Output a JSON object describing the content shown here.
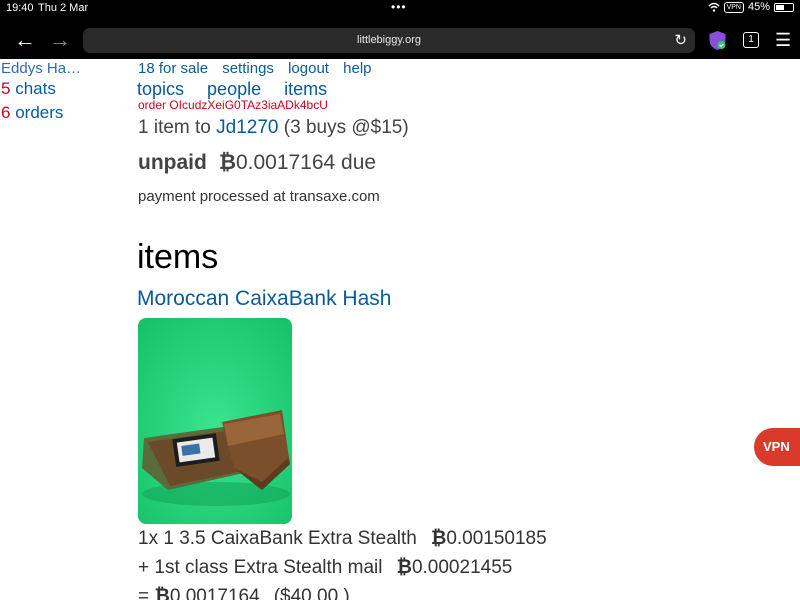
{
  "status_bar": {
    "time": "19:40",
    "date": "Thu 2 Mar",
    "dots": "•••",
    "vpn": "VPN",
    "battery": "45%"
  },
  "browser": {
    "url": "littlebiggy.org",
    "tab_count": "1",
    "back_icon": "←",
    "forward_icon": "→",
    "reload_icon": "↻",
    "menu_icon": "☰"
  },
  "sidebar": {
    "shop_name": "Eddys Ha…",
    "chats_count": "5",
    "chats_label": "chats",
    "orders_count": "6",
    "orders_label": "orders"
  },
  "top_links": [
    "18 for sale",
    "settings",
    "logout",
    "help"
  ],
  "nav_links": [
    "topics",
    "people",
    "items"
  ],
  "order": {
    "id": "order OIcudzXeiG0TAz3iaADk4bcU",
    "summary_prefix": "1 item to",
    "buyer": "Jd1270",
    "summary_suffix": "(3 buys @$15)",
    "status": "unpaid",
    "btc_symbol": "₿",
    "due": "0.0017164 due",
    "processed": "payment processed at transaxe.com"
  },
  "items_heading": "items",
  "product": {
    "title": "Moroccan CaixaBank Hash",
    "line1_text": "1x 1 3.5 CaixaBank Extra Stealth",
    "line1_amount": "0.00150185",
    "line2_text": "+ 1st class Extra Stealth mail",
    "line2_amount": "0.00021455",
    "line3_prefix": "=",
    "line3_amount": "0.0017164",
    "line3_usd": "($40.00 )"
  },
  "vpn_button": "VPN",
  "colors": {
    "link": "#0a5a9a",
    "count": "#d0021b",
    "vpn": "#d93a2b",
    "image_bg": "#22d27a"
  }
}
